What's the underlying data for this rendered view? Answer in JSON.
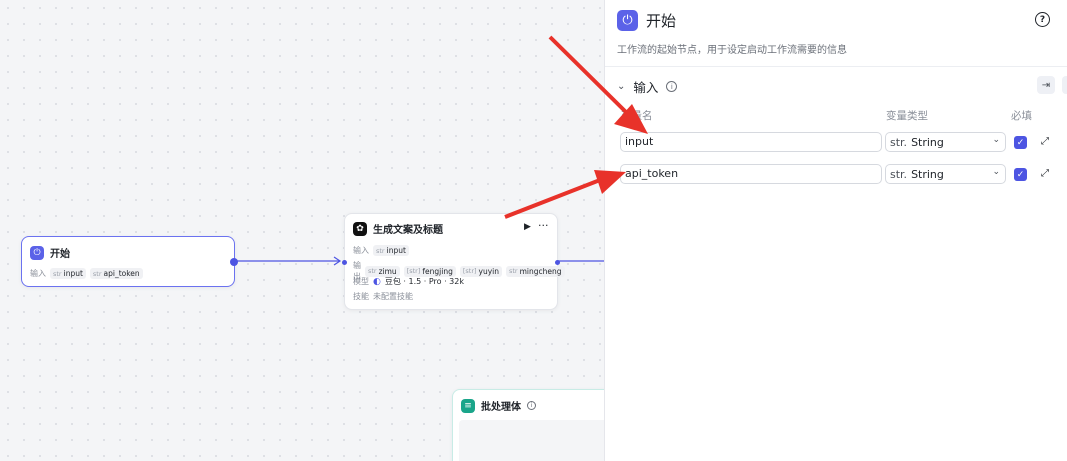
{
  "canvas": {
    "start_node": {
      "title": "开始",
      "input_label": "输入",
      "inputs": [
        {
          "type": "str",
          "name": "input"
        },
        {
          "type": "str",
          "name": "api_token"
        }
      ]
    },
    "llm_node": {
      "title": "生成文案及标题",
      "input_label": "输入",
      "inputs": [
        {
          "type": "str",
          "name": "input"
        }
      ],
      "output_label": "输出",
      "outputs": [
        {
          "type": "str",
          "name": "zimu"
        },
        {
          "type": "[str]",
          "name": "fengjing"
        },
        {
          "type": "[str]",
          "name": "yuyin"
        },
        {
          "type": "str",
          "name": "mingcheng"
        }
      ],
      "model_label": "模型",
      "model_value": "豆包 · 1.5 · Pro · 32k",
      "skill_label": "技能",
      "skill_value": "未配置技能"
    },
    "batch_node": {
      "title": "批处理体"
    }
  },
  "panel": {
    "title": "开始",
    "description": "工作流的起始节点，用于设定启动工作流需要的信息",
    "section_title": "输入",
    "col_var_name": "变量名",
    "col_var_type": "变量类型",
    "col_required": "必填",
    "rows": [
      {
        "name": "input",
        "type_prefix": "str.",
        "type": "String",
        "required": true
      },
      {
        "name": "api_token",
        "type_prefix": "str.",
        "type": "String",
        "required": true
      }
    ]
  },
  "colors": {
    "accent": "#4d55e2",
    "arrow": "#e8322a"
  }
}
